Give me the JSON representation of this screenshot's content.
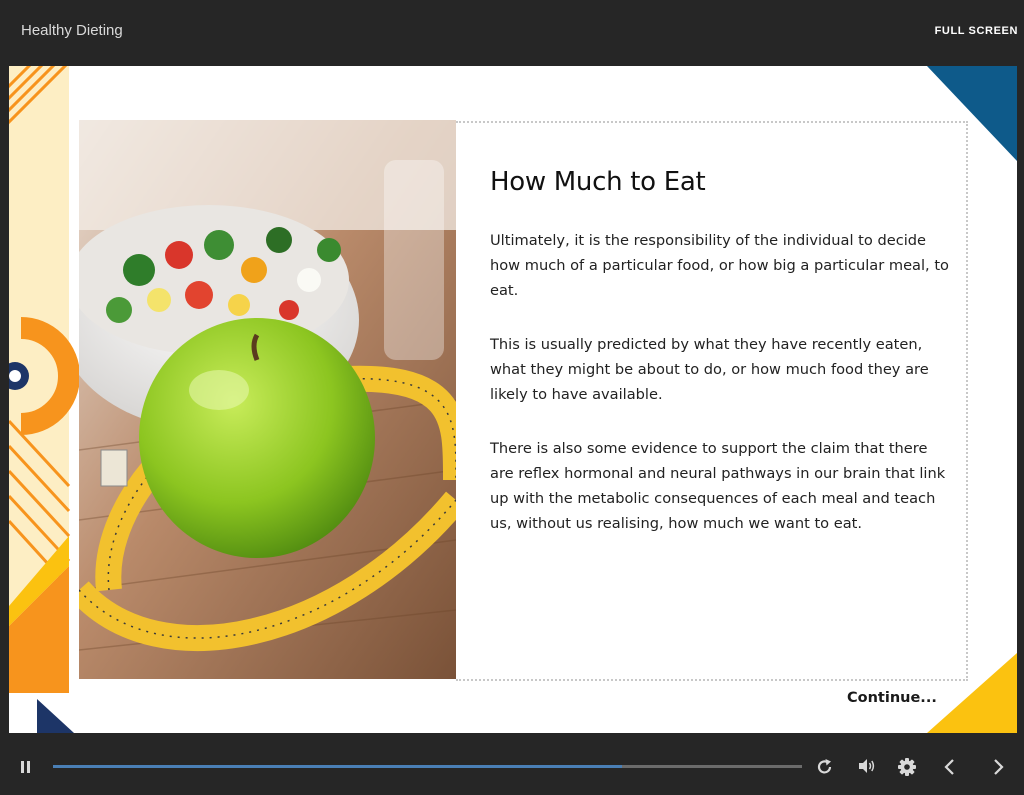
{
  "header": {
    "course_title": "Healthy Dieting",
    "fullscreen_label": "FULL SCREEN"
  },
  "slide": {
    "heading": "How Much to Eat",
    "paragraphs": [
      "Ultimately, it is the responsibility of the individual to decide how much of a particular food, or how big a particular meal, to eat.",
      "This is usually predicted by what they have recently eaten, what they might be about to do, or how much food they are likely to have available.",
      "There is also some evidence to support the claim that there are reflex hormonal and neural pathways in our brain that link up with the metabolic consequences of each meal and teach us, without us realising, how much we want to eat."
    ],
    "continue_label": "Continue...",
    "image_description": "green apple with measuring tape and salad"
  },
  "player": {
    "progress": 0.76,
    "icons": [
      "pause-icon",
      "replay-icon",
      "volume-icon",
      "settings-icon",
      "previous-icon",
      "next-icon"
    ]
  },
  "colors": {
    "bar_bg": "#262626",
    "accent_orange": "#f7941d",
    "accent_yellow": "#fbc210",
    "accent_navy": "#1d3567",
    "accent_blue": "#0e5a8a",
    "pale_yellow": "#fdeec4",
    "progress": "#4a7fb5"
  }
}
